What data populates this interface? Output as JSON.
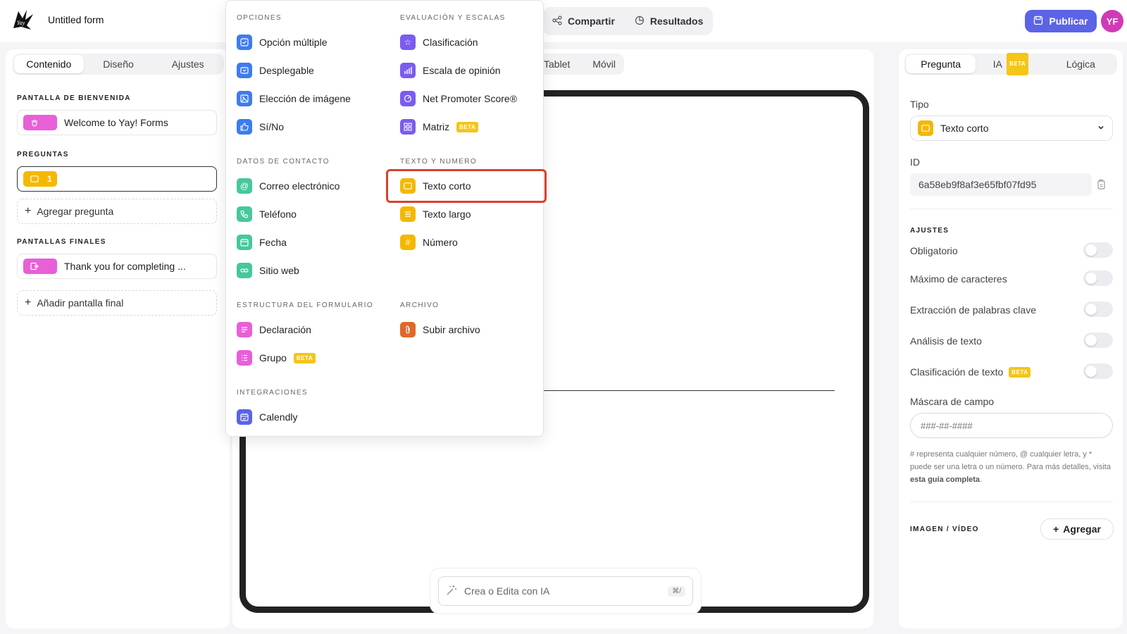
{
  "header": {
    "form_title": "Untitled form",
    "share_label": "Compartir",
    "results_label": "Resultados",
    "publish_label": "Publicar",
    "avatar_initials": "YF"
  },
  "left": {
    "tabs": [
      "Contenido",
      "Diseño",
      "Ajustes"
    ],
    "welcome_section": "PANTALLA DE BIENVENIDA",
    "welcome_item": "Welcome to Yay! Forms",
    "questions_section": "PREGUNTAS",
    "question_number": "1",
    "add_question": "Agregar pregunta",
    "end_section": "PANTALLAS FINALES",
    "end_item": "Thank you for completing ...",
    "add_end": "Añadir pantalla final"
  },
  "center": {
    "device_tabs": [
      "Tablet",
      "Móvil"
    ],
    "ai_placeholder": "Crea o Edita con IA",
    "ai_shortcut": "⌘/"
  },
  "dropdown": {
    "beta": "BETA",
    "col1": [
      {
        "section": "OPCIONES",
        "items": [
          "Opción múltiple",
          "Desplegable",
          "Elección de imágene",
          "Sí/No"
        ]
      },
      {
        "section": "DATOS DE CONTACTO",
        "items": [
          "Correo electrónico",
          "Teléfono",
          "Fecha",
          "Sitio web"
        ]
      },
      {
        "section": "ESTRUCTURA DEL FORMULARIO",
        "items": [
          "Declaración",
          "Grupo"
        ]
      },
      {
        "section": "INTEGRACIONES",
        "items": [
          "Calendly"
        ]
      }
    ],
    "col2": [
      {
        "section": "EVALUACIÓN Y ESCALAS",
        "items": [
          "Clasificación",
          "Escala de opinión",
          "Net Promoter Score®",
          "Matriz"
        ]
      },
      {
        "section": "TEXTO Y NUMERO",
        "items": [
          "Texto corto",
          "Texto largo",
          "Número"
        ]
      },
      {
        "section": "ARCHIVO",
        "items": [
          "Subir archivo"
        ]
      }
    ]
  },
  "right": {
    "tabs": [
      "Pregunta",
      "IA",
      "Lógica"
    ],
    "type_label": "Tipo",
    "type_value": "Texto corto",
    "id_label": "ID",
    "id_value": "6a58eb9f8af3e65fbf07fd95",
    "settings_section": "AJUSTES",
    "settings": [
      "Obligatorio",
      "Máximo de caracteres",
      "Extracción de palabras clave",
      "Análisis de texto",
      "Clasificación de texto"
    ],
    "mask_label": "Máscara de campo",
    "mask_placeholder": "###-##-####",
    "help_text": "# representa cualquier número, @ cualquier letra, y * puede ser una letra o un número. Para más detalles, visita",
    "help_link": "esta guía completa",
    "help_end": ".",
    "media_section": "IMAGEN / VÍDEO",
    "add_label": "Agregar"
  },
  "colors": {
    "accent": "#5b63e6",
    "yellow": "#f5b800",
    "pink": "#e85fd8",
    "blue": "#3d7cf0",
    "purple": "#7a5cf0",
    "green": "#46c89a",
    "orange": "#e0672a",
    "highlight": "#d9412e"
  }
}
